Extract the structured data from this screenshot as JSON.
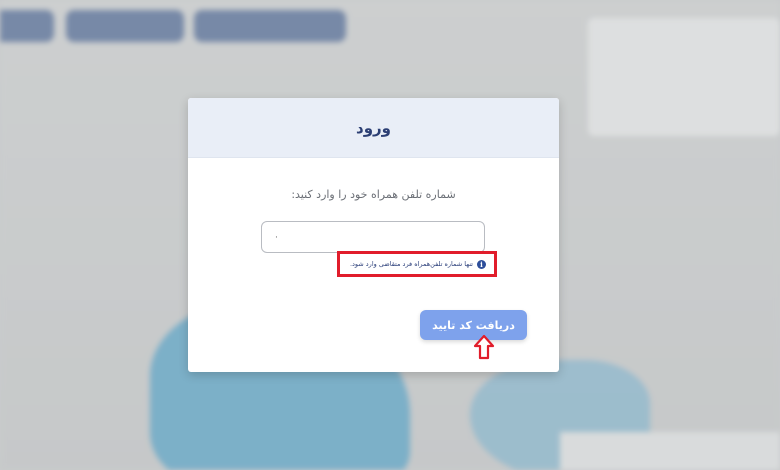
{
  "modal": {
    "title": "ورود",
    "prompt": "شماره تلفن همراه خود را وارد کنید:",
    "phone_input": {
      "value": "",
      "placeholder": ""
    },
    "hint": "تنها شماره تلفن‌همراه فرد متقاضی وارد شود.",
    "submit_label": "دریافت کد تایید"
  },
  "icons": {
    "info": "info-icon",
    "arrow": "arrow-up-icon"
  },
  "colors": {
    "header_bg": "#e9eef7",
    "title": "#2c3f74",
    "button": "#7ea2ec",
    "highlight": "#e11d2b"
  }
}
